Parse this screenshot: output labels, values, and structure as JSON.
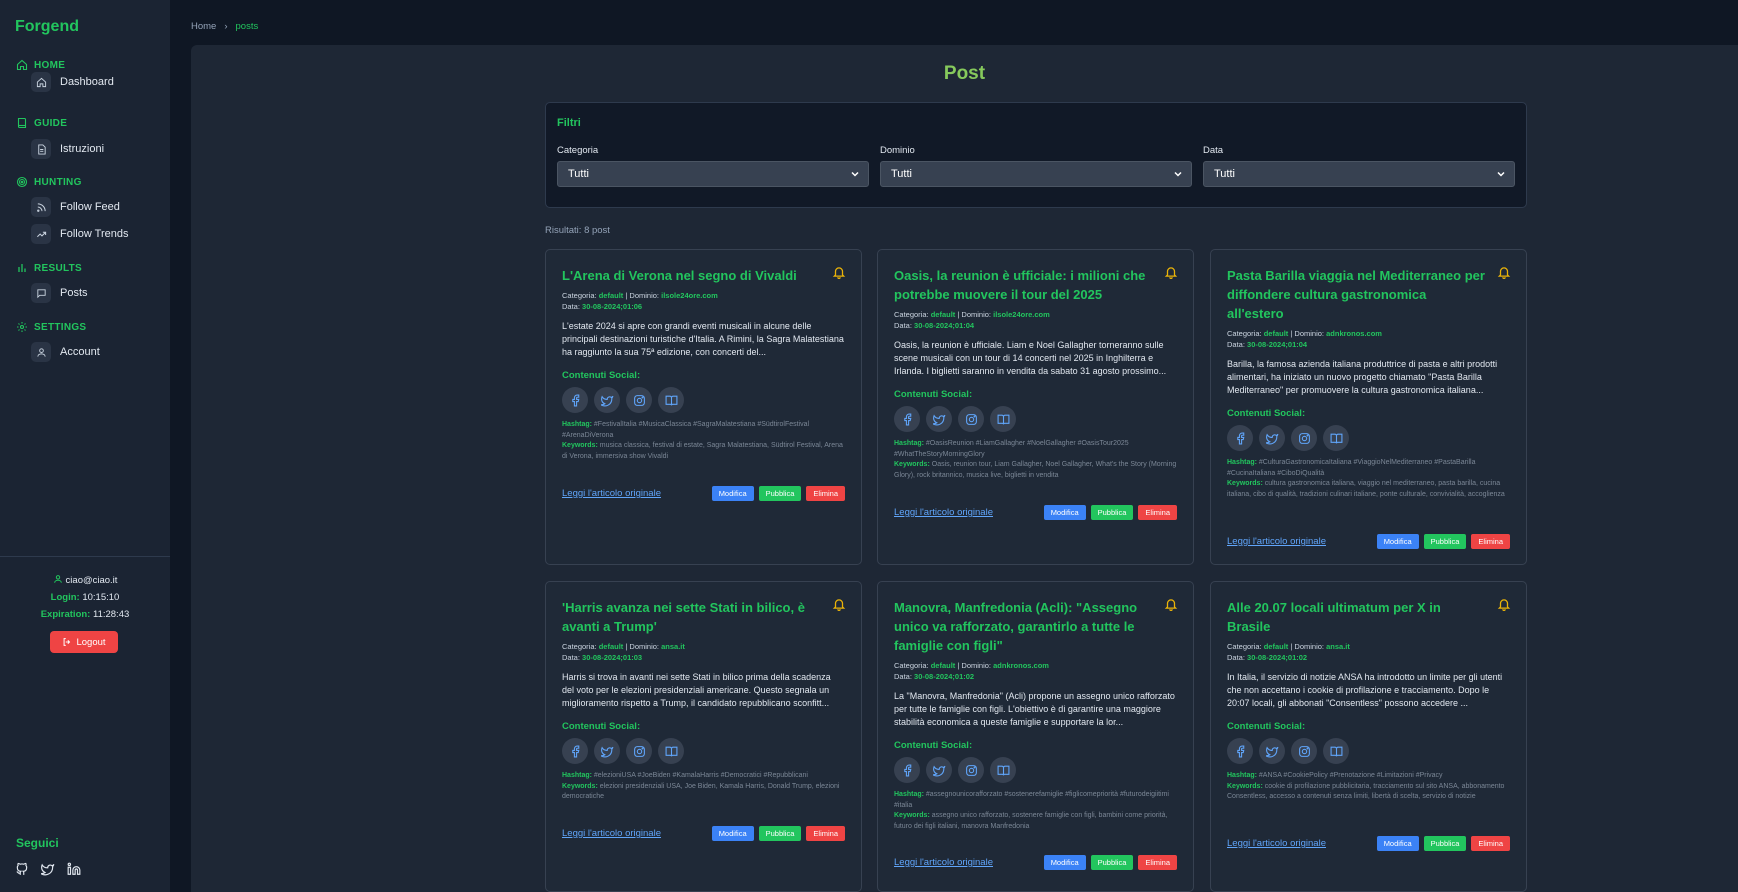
{
  "app": {
    "brand": "Forgend"
  },
  "sidebar": {
    "sections": [
      {
        "label": "HOME",
        "icon": "home-icon",
        "items": [
          {
            "label": "Dashboard",
            "icon": "home-icon"
          }
        ]
      },
      {
        "label": "GUIDE",
        "icon": "book-icon",
        "items": [
          {
            "label": "Istruzioni",
            "icon": "document-icon"
          }
        ]
      },
      {
        "label": "HUNTING",
        "icon": "target-icon",
        "items": [
          {
            "label": "Follow Feed",
            "icon": "rss-icon"
          },
          {
            "label": "Follow Trends",
            "icon": "trending-icon"
          }
        ]
      },
      {
        "label": "RESULTS",
        "icon": "bar-chart-icon",
        "items": [
          {
            "label": "Posts",
            "icon": "message-icon"
          }
        ]
      },
      {
        "label": "SETTINGS",
        "icon": "gear-icon",
        "items": [
          {
            "label": "Account",
            "icon": "user-icon"
          }
        ]
      }
    ],
    "user": {
      "email": "ciao@ciao.it",
      "login_label": "Login:",
      "login_time": "10:15:10",
      "expiration_label": "Expiration:",
      "expiration_time": "11:28:43"
    },
    "logout_label": "Logout",
    "follow_label": "Seguici",
    "social_icons": [
      "github-icon",
      "twitter-icon",
      "linkedin-icon"
    ]
  },
  "breadcrumb": {
    "home": "Home",
    "separator": "›",
    "current": "posts"
  },
  "main": {
    "title": "Post",
    "filters": {
      "title": "Filtri",
      "category": {
        "label": "Categoria",
        "value": "Tutti"
      },
      "domain": {
        "label": "Dominio",
        "value": "Tutti"
      },
      "date": {
        "label": "Data",
        "value": "Tutti"
      }
    },
    "results_text": "Risultati: 8 post",
    "labels": {
      "category": "Categoria:",
      "domain": "Dominio:",
      "date": "Data:",
      "social": "Contenuti Social:",
      "hashtag": "Hashtag:",
      "keywords": "Keywords:",
      "original": "Leggi l'articolo originale",
      "edit": "Modifica",
      "publish": "Pubblica",
      "delete": "Elimina"
    },
    "posts": [
      {
        "title": "L'Arena di Verona nel segno di Vivaldi",
        "category": "default",
        "domain": "ilsole24ore.com",
        "date": "30-08-2024;01:06",
        "desc": "L'estate 2024 si apre con grandi eventi musicali in alcune delle principali destinazioni turistiche d'Italia. A Rimini, la Sagra Malatestiana ha raggiunto la sua 75ª edizione, con concerti del...",
        "hashtags": "#FestivalItalia #MusicaClassica #SagraMalatestiana #SüdtirolFestival #ArenaDiVerona",
        "keywords": "musica classica, festival di estate, Sagra Malatestiana, Südtirol Festival, Arena di Verona, immersiva show Vivaldi"
      },
      {
        "title": "Oasis, la reunion è ufficiale: i milioni che potrebbe muovere il tour del 2025",
        "category": "default",
        "domain": "ilsole24ore.com",
        "date": "30-08-2024;01:04",
        "desc": "Oasis, la reunion è ufficiale. Liam e Noel Gallagher torneranno sulle scene musicali con un tour di 14 concerti nel 2025 in Inghilterra e Irlanda. I biglietti saranno in vendita da sabato 31 agosto prossimo...",
        "hashtags": "#OasisReunion #LiamGallagher #NoelGallagher #OasisTour2025 #WhatTheStoryMorningGlory",
        "keywords": "Oasis, reunion tour, Liam Gallagher, Noel Gallagher, What's the Story (Morning Glory), rock britannico, musica live, biglietti in vendita"
      },
      {
        "title": "Pasta Barilla viaggia nel Mediterraneo per diffondere cultura gastronomica all'estero",
        "category": "default",
        "domain": "adnkronos.com",
        "date": "30-08-2024;01:04",
        "desc": "Barilla, la famosa azienda italiana produttrice di pasta e altri prodotti alimentari, ha iniziato un nuovo progetto chiamato \"Pasta Barilla Mediterraneo\" per promuovere la cultura gastronomica italiana...",
        "hashtags": "#CulturaGastronomicaItaliana #ViaggioNelMediterraneo #PastaBarilla #CucinaItaliana #CiboDiQualità",
        "keywords": "cultura gastronomica italiana, viaggio nel mediterraneo, pasta barilla, cucina italiana, cibo di qualità, tradizioni culinari italiane, ponte culturale, convivialità, accoglienza"
      },
      {
        "title": "'Harris avanza nei sette Stati in bilico, è avanti a Trump'",
        "category": "default",
        "domain": "ansa.it",
        "date": "30-08-2024;01:03",
        "desc": "Harris si trova in avanti nei sette Stati in bilico prima della scadenza del voto per le elezioni presidenziali americane. Questo segnala un miglioramento rispetto a Trump, il candidato repubblicano sconfitt...",
        "hashtags": "#elezioniUSA #JoeBiden #KamalaHarris #Democratici #Repubblicani",
        "keywords": "elezioni presidenziali USA, Joe Biden, Kamala Harris, Donald Trump, elezioni democratiche"
      },
      {
        "title": "Manovra, Manfredonia (Acli): \"Assegno unico va rafforzato, garantirlo a tutte le famiglie con figli\"",
        "category": "default",
        "domain": "adnkronos.com",
        "date": "30-08-2024;01:02",
        "desc": "La \"Manovra, Manfredonia\" (Acli) propone un assegno unico rafforzato per tutte le famiglie con figli. L'obiettivo è di garantire una maggiore stabilità economica a queste famiglie e supportare la lor...",
        "hashtags": "#assegnounicorafforzato #sostenerefamiglie #figlicomepriorità #futurodeigiitimi #italia",
        "keywords": "assegno unico rafforzato, sostenere famiglie con figli, bambini come priorità, futuro dei figli italiani, manovra Manfredonia"
      },
      {
        "title": "Alle 20.07 locali ultimatum per X in Brasile",
        "category": "default",
        "domain": "ansa.it",
        "date": "30-08-2024;01:02",
        "desc": "In Italia, il servizio di notizie ANSA ha introdotto un limite per gli utenti che non accettano i cookie di profilazione e tracciamento. Dopo le 20:07 locali, gli abbonati \"Consentless\" possono accedere ...",
        "hashtags": "#ANSA #CookiePolicy #Prenotazione #Limitazioni #Privacy",
        "keywords": "cookie di profilazione pubblicitaria, tracciamento sul sito ANSA, abbonamento Consentless, accesso a contenuti senza limiti, libertà di scelta, servizio di notizie"
      }
    ]
  }
}
